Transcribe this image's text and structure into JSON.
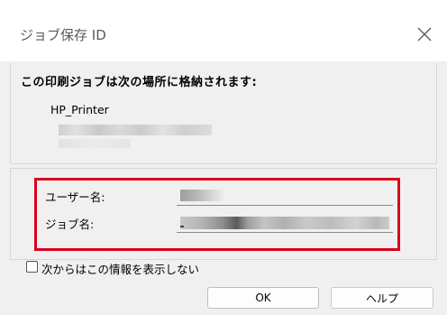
{
  "window": {
    "title": "ジョブ保存 ID"
  },
  "info": {
    "message": "この印刷ジョブは次の場所に格納されます:",
    "printer_name": "HP_Printer"
  },
  "form": {
    "user_label": "ユーザー名:",
    "job_label": "ジョブ名:"
  },
  "options": {
    "dont_show_label": "次からはこの情報を表示しない",
    "dont_show_checked": false
  },
  "buttons": {
    "ok_label": "OK",
    "help_label": "ヘルプ"
  },
  "icons": {
    "close": "close-icon"
  },
  "colors": {
    "highlight": "#d9001b",
    "background": "#f0f0f0"
  }
}
